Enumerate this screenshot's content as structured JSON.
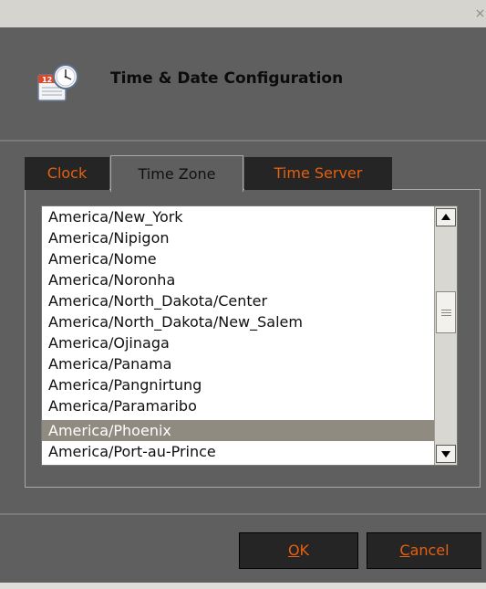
{
  "window": {
    "close_glyph": "×"
  },
  "header": {
    "title": "Time & Date Configuration",
    "icon": "calendar-clock-icon"
  },
  "tabs": [
    {
      "label": "Clock",
      "active": false
    },
    {
      "label": "Time Zone",
      "active": true
    },
    {
      "label": "Time Server",
      "active": false
    }
  ],
  "timezone_list": {
    "items": [
      "America/New_York",
      "America/Nipigon",
      "America/Nome",
      "America/Noronha",
      "America/North_Dakota/Center",
      "America/North_Dakota/New_Salem",
      "America/Ojinaga",
      "America/Panama",
      "America/Pangnirtung",
      "America/Paramaribo",
      "America/Phoenix",
      "America/Port-au-Prince"
    ],
    "selected": "America/Phoenix"
  },
  "buttons": {
    "ok_mnemonic": "O",
    "ok_rest": "K",
    "cancel_mnemonic": "C",
    "cancel_rest": "ancel"
  },
  "colors": {
    "accent_text": "#e56010",
    "panel_bg": "#5f5f5f",
    "dark_tab_bg": "#252525",
    "selection_bg": "#8f8b81"
  }
}
